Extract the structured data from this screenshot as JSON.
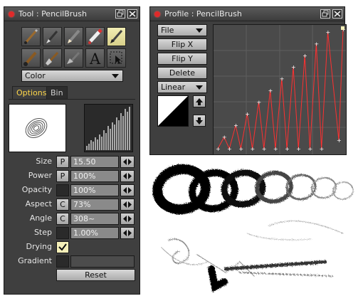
{
  "tool_panel": {
    "title": "Tool : PencilBrush",
    "tools": [
      {
        "name": "brush-tool-icon",
        "active": false
      },
      {
        "name": "pen-tool-icon",
        "active": false
      },
      {
        "name": "pencil-tool-icon",
        "active": false
      },
      {
        "name": "marker-tool-icon",
        "active": false
      },
      {
        "name": "pencil-brush-tool-icon",
        "active": true
      },
      {
        "name": "paintbrush-tool-icon",
        "active": false
      },
      {
        "name": "wide-brush-tool-icon",
        "active": false
      },
      {
        "name": "smudge-tool-icon",
        "active": false
      },
      {
        "name": "text-tool-icon",
        "active": false,
        "glyph": "A"
      },
      {
        "name": "selection-tool-icon",
        "active": false
      }
    ],
    "color_dropdown": "Color",
    "tabs": [
      "Options",
      "Bin"
    ],
    "params": [
      {
        "label": "Size",
        "mode": "P",
        "value": "15.50"
      },
      {
        "label": "Power",
        "mode": "P",
        "value": "100%"
      },
      {
        "label": "Opacity",
        "mode": "",
        "value": "100%"
      },
      {
        "label": "Aspect",
        "mode": "C",
        "value": "73%"
      },
      {
        "label": "Angle",
        "mode": "C",
        "value": "308~"
      },
      {
        "label": "Step",
        "mode": "",
        "value": "1.00%"
      }
    ],
    "drying_label": "Drying",
    "drying_checked": true,
    "gradient_label": "Gradient",
    "reset_label": "Reset"
  },
  "profile_panel": {
    "title": "Profile : PencilBrush",
    "file_dropdown": "File",
    "buttons": [
      "Flip X",
      "Flip Y",
      "Delete"
    ],
    "interp_dropdown": "Linear",
    "curve_color": "#ff3030"
  }
}
